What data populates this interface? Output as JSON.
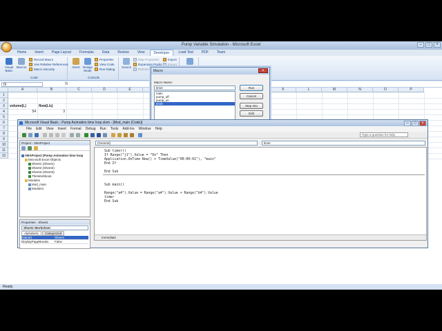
{
  "excel": {
    "title": "Pump Variable Simulation - Microsoft Excel",
    "tabs": [
      "Home",
      "Insert",
      "Page Layout",
      "Formulas",
      "Data",
      "Review",
      "View",
      "Developer",
      "Load Test",
      "PDF",
      "Team"
    ],
    "active_tab": "Developer",
    "ribbon": {
      "visual_basic": "Visual Basic",
      "macros": "Macros",
      "record_macro": "Record Macro",
      "use_relative": "Use Relative References",
      "macro_security": "Macro Security",
      "code_group": "Code",
      "insert": "Insert",
      "design_mode": "Design Mode",
      "properties": "Properties",
      "view_code": "View Code",
      "run_dialog": "Run Dialog",
      "controls_group": "Controls",
      "source": "Source",
      "map_properties": "Map Properties",
      "expansion_packs": "Expansion Packs",
      "refresh_data": "Refresh Data",
      "import": "Import",
      "export": "Export",
      "document_panel": "Document Panel",
      "modify_group": "Modify"
    },
    "name_box": "I9",
    "fx": "fx",
    "columns": [
      "A",
      "B",
      "C",
      "D",
      "E",
      "F",
      "G",
      "H",
      "I",
      "J",
      "K",
      "L",
      "M",
      "N",
      "O",
      "P"
    ],
    "rows": [
      "1",
      "2",
      "3",
      "4",
      "5",
      "6",
      "7",
      "8",
      "9",
      "10",
      "11",
      "12"
    ],
    "cells": {
      "a3": "volume(L)",
      "b3": "flow(L/s)",
      "a4": "54",
      "b4": "3"
    },
    "status": "Ready"
  },
  "macro_dialog": {
    "title": "Macro",
    "macro_name_label": "Macro Name:",
    "macro_name_value": "timer",
    "macros": [
      "main",
      "pump_off",
      "pump_on",
      "timer"
    ],
    "selected": "timer",
    "buttons": {
      "run": "Run",
      "cancel": "Cancel",
      "step_into": "Step Into",
      "edit": "Edit",
      "create": "Create",
      "delete": "Delete"
    },
    "macros_in_label": "Macros In:",
    "macros_in_value": "VBAProject (Pump Animation time loop.xlsm)"
  },
  "vbe": {
    "title": "Microsoft Visual Basic - Pump Animation time loop.xlsm - [Mod_main (Code)]",
    "menu": [
      "File",
      "Edit",
      "View",
      "Insert",
      "Format",
      "Debug",
      "Run",
      "Tools",
      "Add-Ins",
      "Window",
      "Help"
    ],
    "ask": "Type a question for help",
    "project_title": "Project - VBAProject",
    "tree": {
      "project": "VBAProject (Pump Animation time loop",
      "excel_objects": "Microsoft Excel Objects",
      "sheet1": "Sheet1 (Sheet1)",
      "sheet2": "Sheet2 (Sheet2)",
      "sheet3": "Sheet3 (Sheet3)",
      "thisworkbook": "ThisWorkbook",
      "modules": "Modules",
      "mod_main": "Mod_main",
      "module1": "Module1"
    },
    "properties_title": "Properties - Sheet1",
    "props_object": "Sheet1 Worksheet",
    "props_tabs": [
      "Alphabetic",
      "Categorized"
    ],
    "props_rows": [
      [
        "(Name)",
        "Sheet1"
      ],
      [
        "DisplayPageBreaks",
        "False"
      ]
    ],
    "combo_left": "(General)",
    "combo_right": "timer",
    "code_block1": [
      "Sub timer()",
      "If Range(\"j1\").Value = \"On\" Then",
      "Application.OnTime Now() + TimeValue(\"00:00:01\"), \"main\"",
      "End If",
      "",
      "End Sub"
    ],
    "code_block2": [
      "Sub main()",
      "",
      "Range(\"a4\").Value = Range(\"a4\").Value + Range(\"b4\").Value",
      "timer",
      "End Sub"
    ],
    "immediate": "Immediate"
  }
}
